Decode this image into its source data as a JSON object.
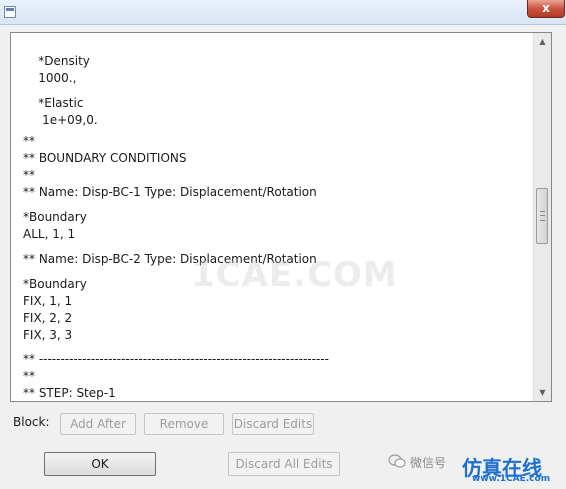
{
  "window": {
    "close_glyph": "x"
  },
  "editor": {
    "lines": [
      "    *Density",
      "    1000.,",
      "",
      "    *Elastic",
      "     1e+09,0.",
      "**",
      "** BOUNDARY CONDITIONS",
      "**",
      "** Name: Disp-BC-1 Type: Displacement/Rotation",
      "*Boundary",
      "ALL, 1, 1",
      "** Name: Disp-BC-2 Type: Displacement/Rotation",
      "*Boundary",
      "FIX, 1, 1",
      "FIX, 2, 2",
      "FIX, 3, 3",
      "** -------------------------------------------------------------------",
      "**",
      "** STEP: Step-1"
    ],
    "scroll_position": 0.5
  },
  "block": {
    "label": "Block:",
    "add_after_label": "Add After",
    "remove_label": "Remove",
    "discard_edits_label": "Discard Edits"
  },
  "footer": {
    "ok_label": "OK",
    "discard_all_label": "Discard All Edits"
  },
  "watermark": {
    "text": "1CAE.COM",
    "wechat": "微信号",
    "brand": "仿真在线",
    "url": "www.1CAE.com",
    "brand_color": "#1d6fd0"
  }
}
